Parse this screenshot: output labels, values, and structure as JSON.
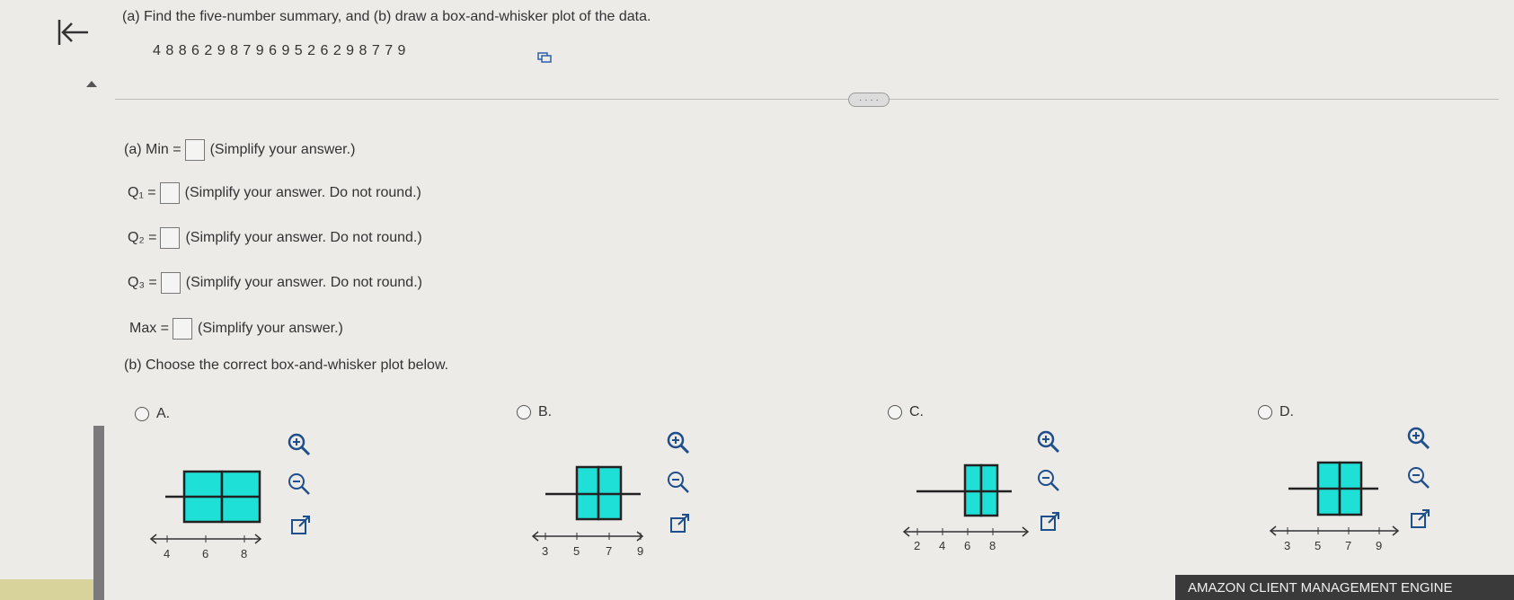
{
  "header": {
    "question": "(a) Find the five-number summary, and (b) draw a box-and-whisker plot of the data.",
    "data_values": "4 8 8 6 2 9 8 7 9 6 9 5 2 6 2 9 8 7 7 9"
  },
  "more_button": "· · · ·",
  "part_a": {
    "rows": [
      {
        "label": "(a) Min =",
        "hint": "(Simplify your answer.)",
        "value": ""
      },
      {
        "label": "Q₁ =",
        "hint": "(Simplify your answer. Do not round.)",
        "value": ""
      },
      {
        "label": "Q₂ =",
        "hint": "(Simplify your answer. Do not round.)",
        "value": ""
      },
      {
        "label": "Q₃ =",
        "hint": "(Simplify your answer. Do not round.)",
        "value": ""
      },
      {
        "label": "Max =",
        "hint": "(Simplify your answer.)",
        "value": ""
      }
    ]
  },
  "part_b": {
    "prompt": "(b) Choose the correct box-and-whisker plot below."
  },
  "options": [
    {
      "label": "A.",
      "ticks": [
        "4",
        "6",
        "8"
      ]
    },
    {
      "label": "B.",
      "ticks": [
        "3",
        "5",
        "7",
        "9"
      ]
    },
    {
      "label": "C.",
      "ticks": [
        "2",
        "4",
        "6",
        "8"
      ]
    },
    {
      "label": "D.",
      "ticks": [
        "3",
        "5",
        "7",
        "9"
      ]
    }
  ],
  "colors": {
    "box_fill": "#1fe0d6",
    "box_stroke": "#222222",
    "accent": "#1f4e8c"
  },
  "icons": {
    "back": "back-to-start-arrow-icon",
    "copy": "copy-data-icon",
    "zoom_in": "zoom-in-icon",
    "zoom_out": "zoom-out-icon",
    "popout": "external-link-icon"
  },
  "banner": "AMAZON CLIENT MANAGEMENT ENGINE"
}
